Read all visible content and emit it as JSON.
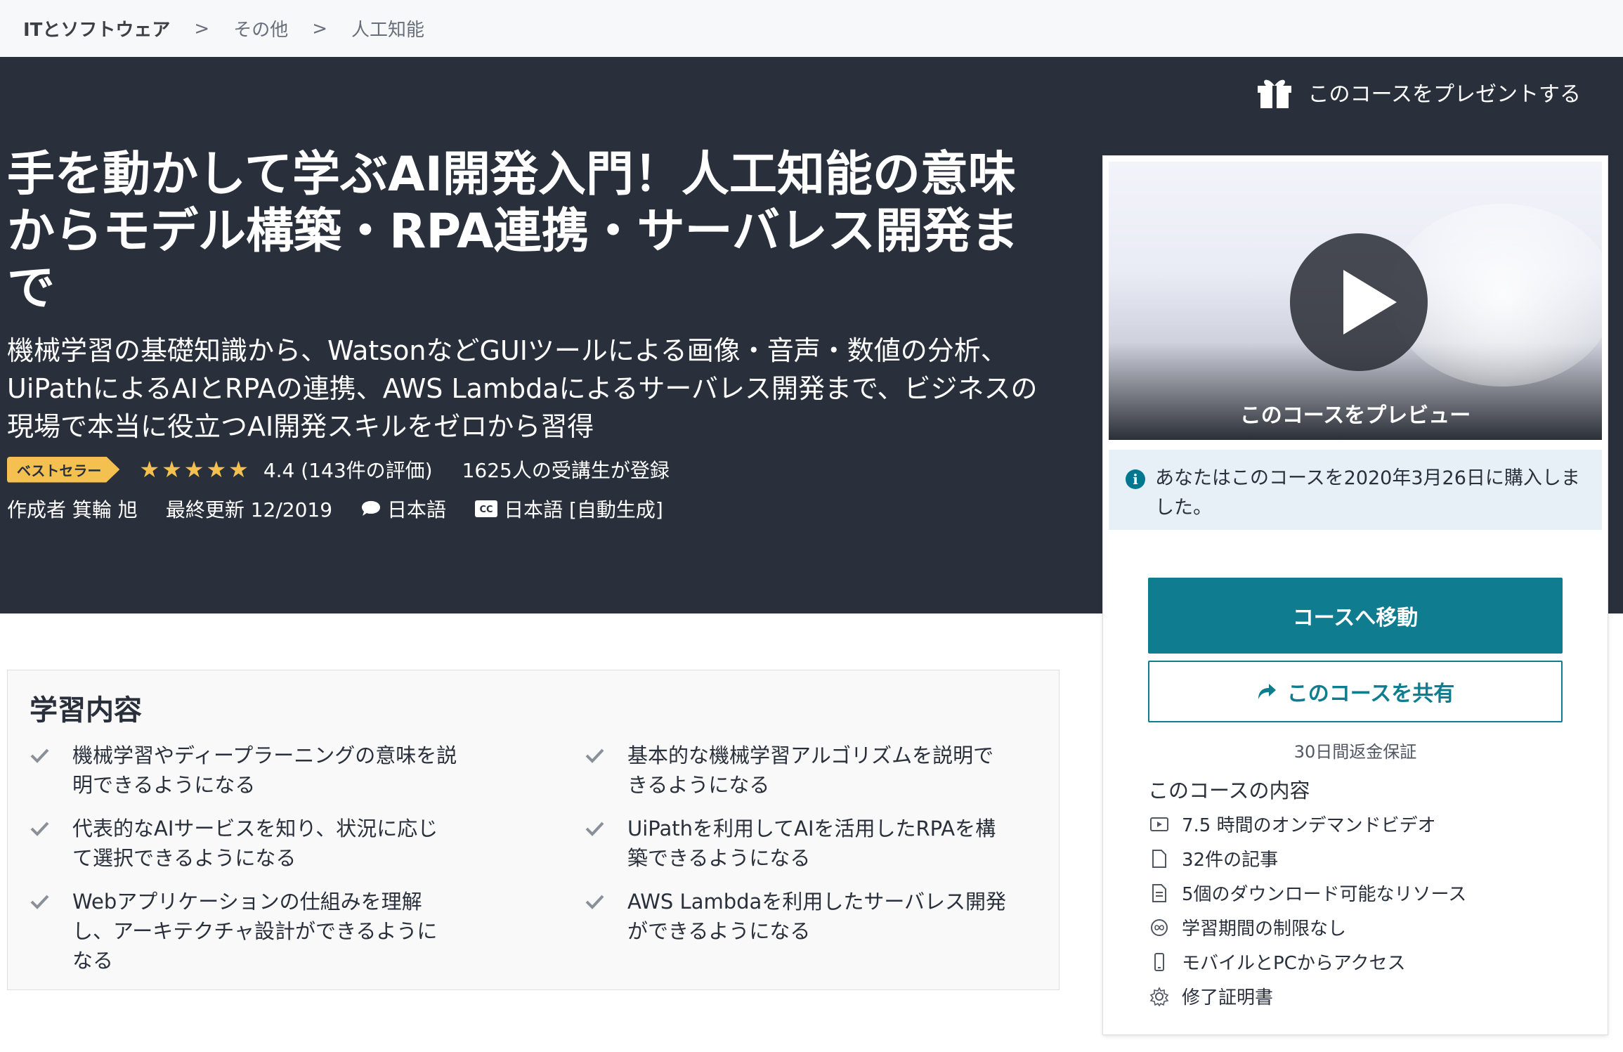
{
  "breadcrumb": {
    "items": [
      "ITとソフトウェア",
      "その他",
      "人工知能"
    ],
    "separator": ">"
  },
  "gift": {
    "label": "このコースをプレゼントする",
    "icon": "gift-icon"
  },
  "course": {
    "title": "手を動かして学ぶAI開発入門！人工知能の意味からモデル構築・RPA連携・サーバレス開発まで",
    "subtitle": "機械学習の基礎知識から、WatsonなどGUIツールによる画像・音声・数値の分析、UiPathによるAIとRPAの連携、AWS Lambdaによるサーバレス開発まで、ビジネスの現場で本当に役立つAI開発スキルをゼロから習得",
    "badge": "ベストセラー",
    "stars": "★★★★★",
    "rating": 4.4,
    "rating_text": "4.4 (143件の評価)",
    "students": "1625人の受講生が登録",
    "author": "作成者 箕輪 旭",
    "updated": "最終更新 12/2019",
    "language": "日本語",
    "captions": "日本語 [自動生成]"
  },
  "sidebar": {
    "preview_label": "このコースをプレビュー",
    "purchased_notice": "あなたはこのコースを2020年3月26日に購入しました。",
    "go_button": "コースへ移動",
    "share_button": "このコースを共有",
    "guarantee": "30日間返金保証",
    "includes_title": "このコースの内容",
    "includes": [
      {
        "icon": "video-icon",
        "label": "7.5 時間のオンデマンドビデオ"
      },
      {
        "icon": "article-icon",
        "label": "32件の記事"
      },
      {
        "icon": "download-icon",
        "label": "5個のダウンロード可能なリソース"
      },
      {
        "icon": "infinity-icon",
        "label": "学習期間の制限なし"
      },
      {
        "icon": "mobile-icon",
        "label": "モバイルとPCからアクセス"
      },
      {
        "icon": "certificate-icon",
        "label": "修了証明書"
      }
    ]
  },
  "learn": {
    "title": "学習内容",
    "items": [
      "機械学習やディープラーニングの意味を説明できるようになる",
      "基本的な機械学習アルゴリズムを説明できるようになる",
      "代表的なAIサービスを知り、状況に応じて選択できるようになる",
      "UiPathを利用してAIを活用したRPAを構築できるようになる",
      "Webアプリケーションの仕組みを理解し、アーキテクチャ設計ができるようになる",
      "AWS Lambdaを利用したサーバレス開発ができるようになる"
    ]
  },
  "colors": {
    "hero_bg": "#29303b",
    "accent": "#0f7c90",
    "badge": "#f4c150",
    "star": "#f4c150"
  }
}
